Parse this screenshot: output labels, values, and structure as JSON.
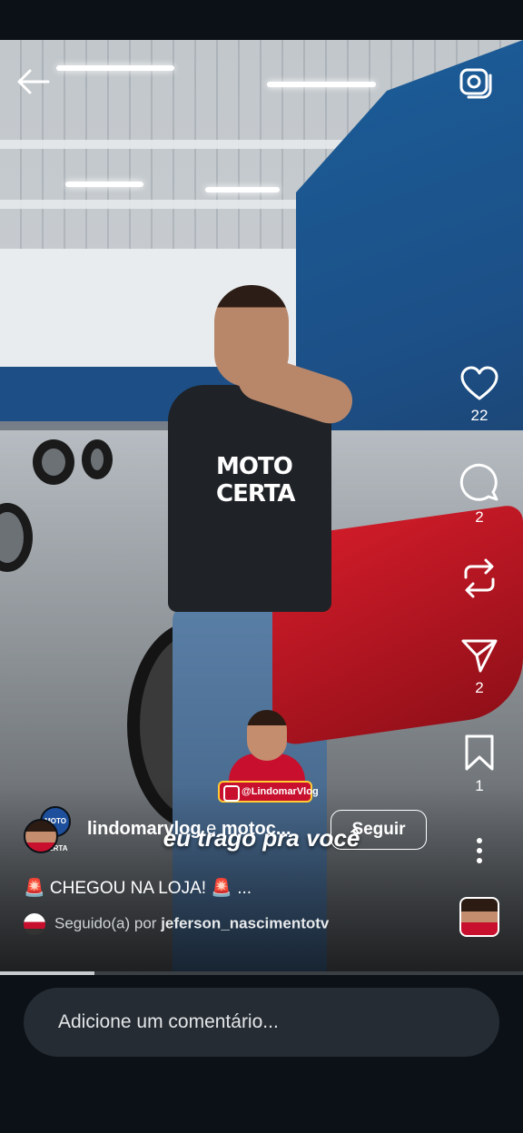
{
  "header": {
    "back_icon": "arrow-left-icon",
    "camera_icon": "camera-icon"
  },
  "video": {
    "overlay_text": "eu trago pra você",
    "shirt_logo": "MOTO CERTA",
    "sticker_handle": "@LindomarVlog"
  },
  "actions": {
    "like": {
      "icon": "heart-icon",
      "count": "22"
    },
    "comment": {
      "icon": "comment-icon",
      "count": "2"
    },
    "repost": {
      "icon": "repost-icon"
    },
    "share": {
      "icon": "send-icon",
      "count": "2"
    },
    "save": {
      "icon": "bookmark-icon",
      "count": "1"
    },
    "more": {
      "icon": "more-vertical-icon"
    }
  },
  "author": {
    "primary": "lindomarvlog",
    "joiner": " e ",
    "secondary": "motoc...",
    "follow_label": "Seguir",
    "avatar_badge": "MOTO CERTA"
  },
  "post": {
    "caption": "🚨 CHEGOU NA LOJA! 🚨 ...",
    "followed_prefix": "Seguido(a) por ",
    "followed_user": "jeferson_nascimentotv"
  },
  "progress": {
    "fraction": 0.18
  },
  "comment": {
    "placeholder": "Adicione um comentário..."
  },
  "colors": {
    "background": "#0b1117",
    "input_bg": "#262c33",
    "accent_red": "#c8102e"
  }
}
